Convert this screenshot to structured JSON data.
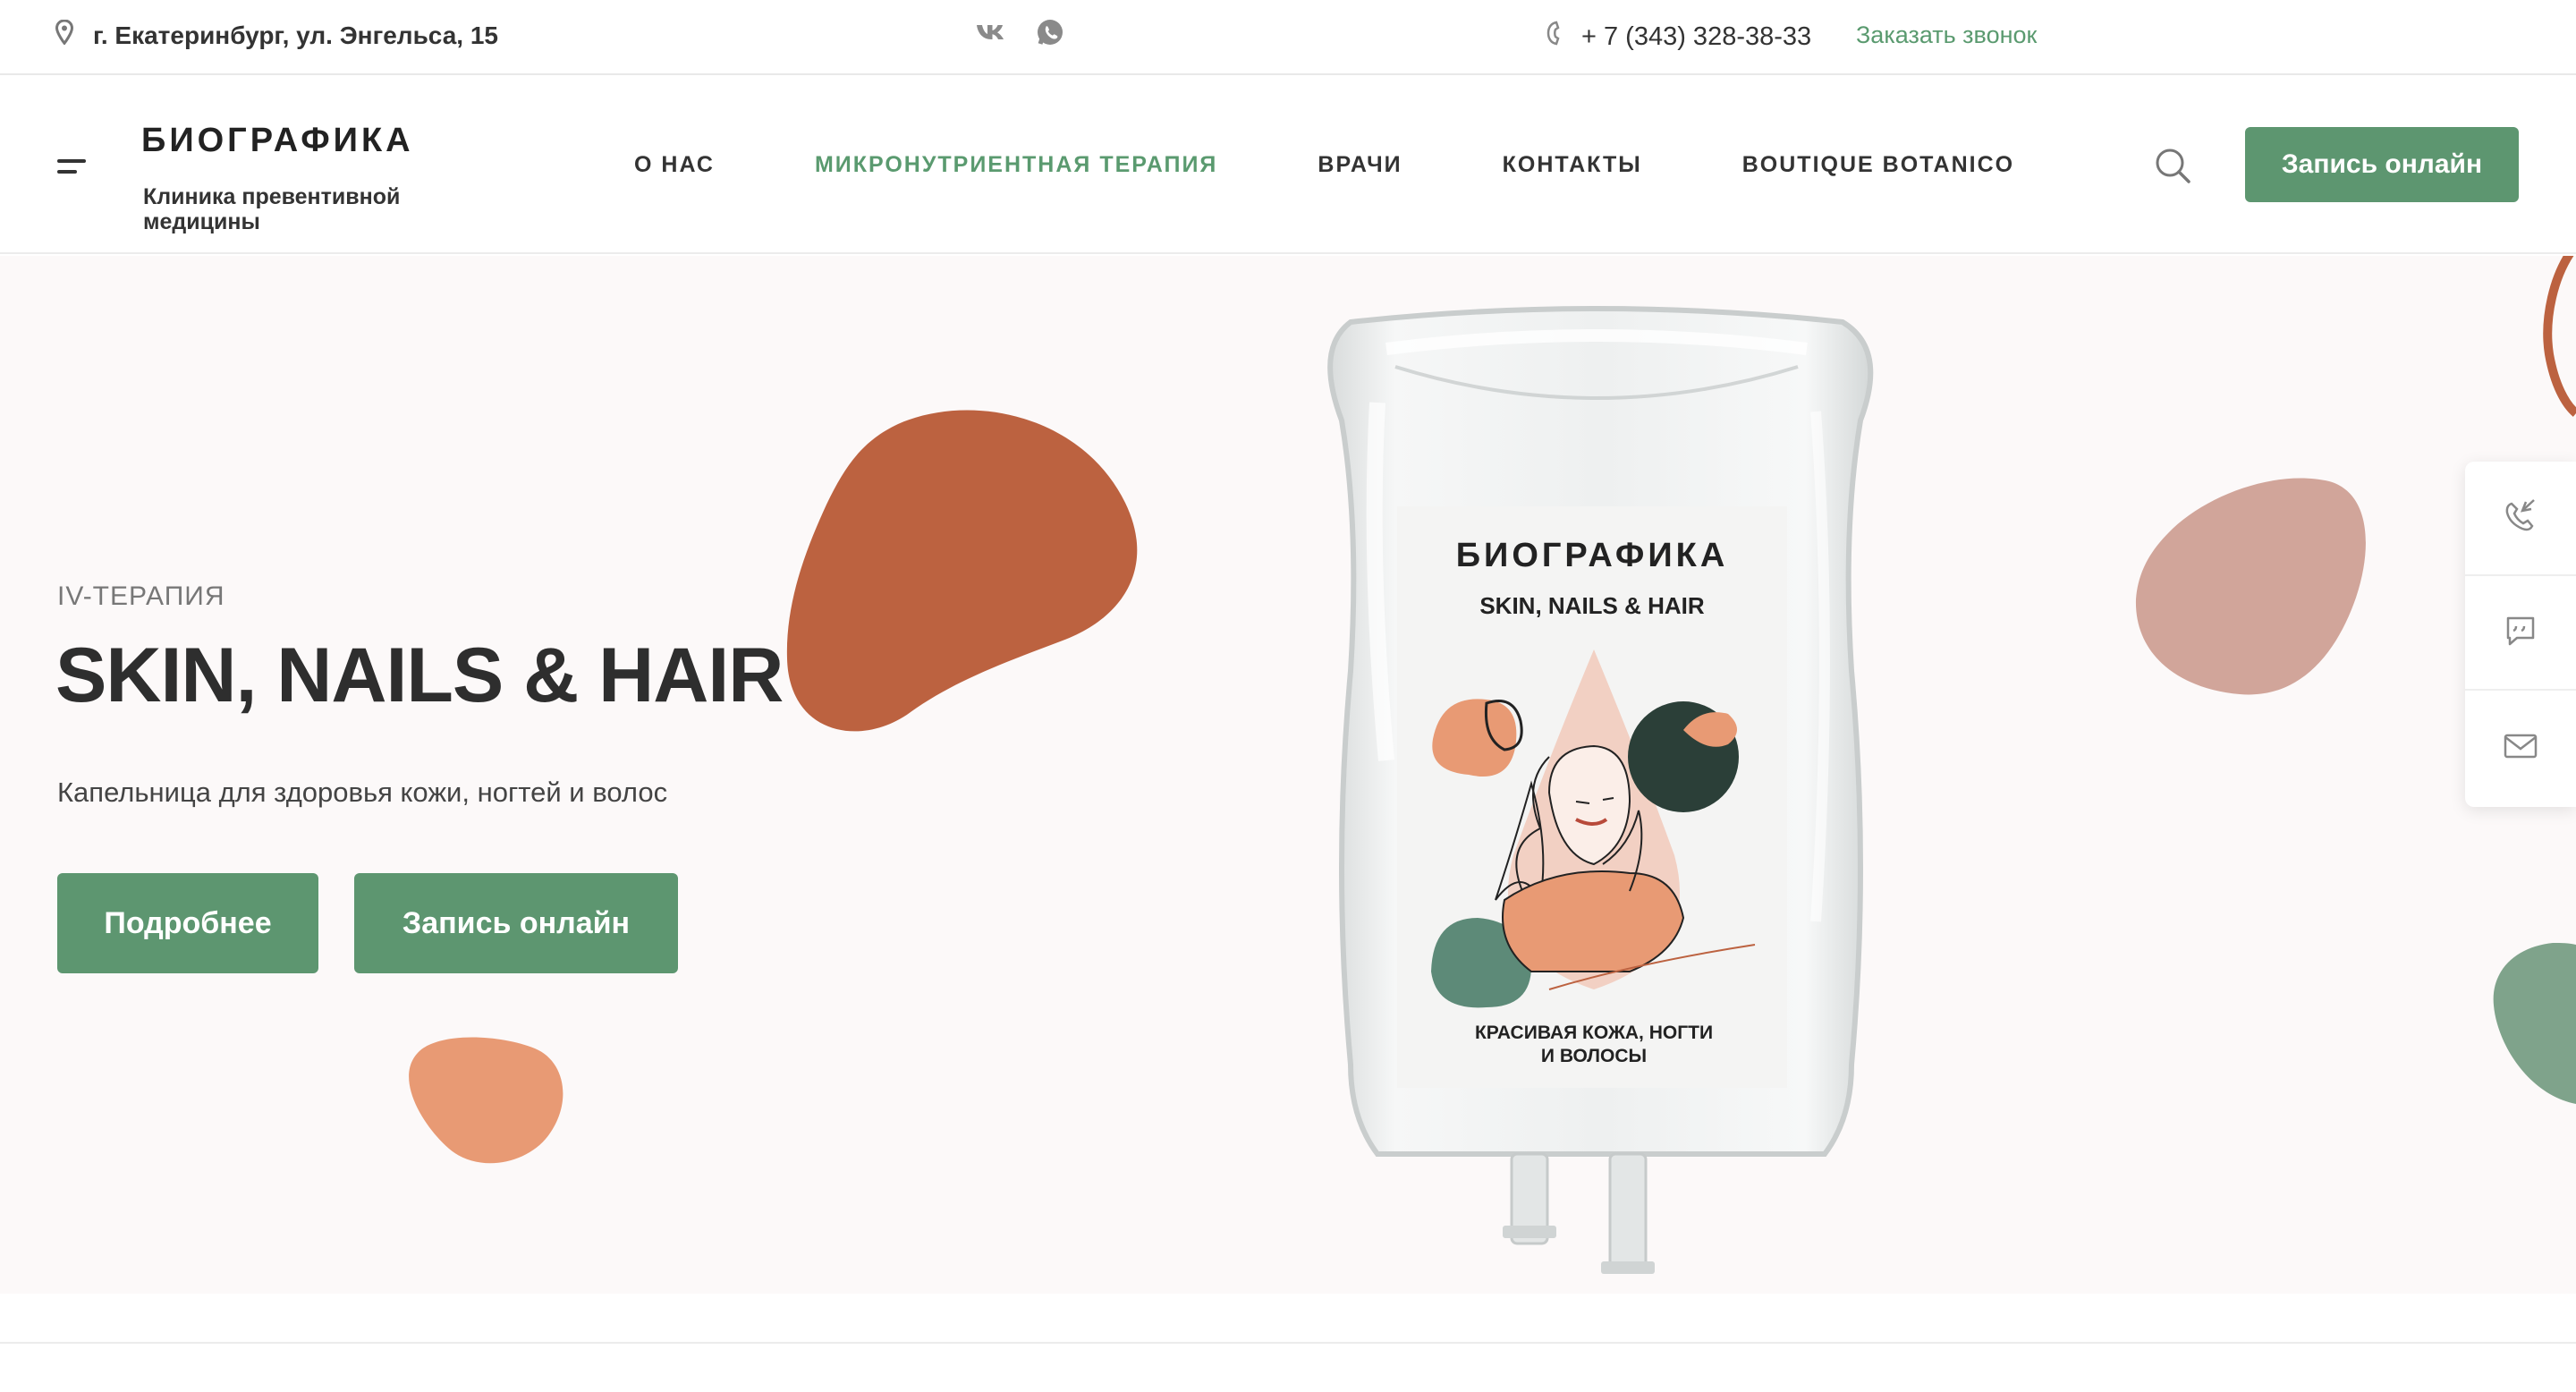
{
  "topbar": {
    "address": "г. Екатеринбург, ул. Энгельса, 15",
    "phone": "+ 7 (343) 328-38-33",
    "callback_label": "Заказать звонок",
    "social": [
      "vk-icon",
      "whatsapp-icon"
    ]
  },
  "header": {
    "logo": "БИОГРАФИКА",
    "logo_subtitle": "Клиника превентивной медицины",
    "nav": [
      {
        "label": "О НАС",
        "active": false
      },
      {
        "label": "МИКРОНУТРИЕНТНАЯ ТЕРАПИЯ",
        "active": true
      },
      {
        "label": "ВРАЧИ",
        "active": false
      },
      {
        "label": "КОНТАКТЫ",
        "active": false
      },
      {
        "label": "BOUTIQUE BOTANICO",
        "active": false
      }
    ],
    "cta_label": "Запись онлайн"
  },
  "hero": {
    "eyebrow": "IV-ТЕРАПИЯ",
    "title": "SKIN, NAILS & HAIR",
    "description": "Капельница для здоровья кожи, ногтей и волос",
    "button_more": "Подробнее",
    "button_book": "Запись онлайн"
  },
  "product_label": {
    "brand": "БИОГРАФИКА",
    "product": "SKIN, NAILS & HAIR",
    "caption_line1": "КРАСИВАЯ КОЖА, НОГТИ",
    "caption_line2": "И ВОЛОСЫ"
  },
  "side_panel": [
    "callback-phone-icon",
    "chat-icon",
    "mail-icon"
  ],
  "colors": {
    "accent_green": "#5d9670",
    "link_green": "#5a9a6f",
    "terracotta": "#bc6240",
    "peach": "#e89a74",
    "dusty_rose": "#d1a59a",
    "sage": "#7fa38b",
    "dark_green": "#2b3f38",
    "hero_bg": "#fcf9f9"
  }
}
